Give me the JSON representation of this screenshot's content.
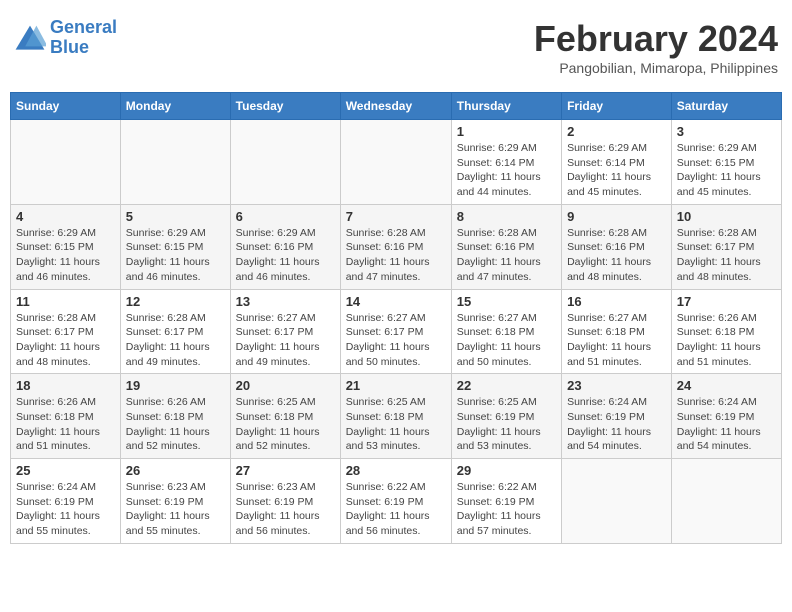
{
  "logo": {
    "line1": "General",
    "line2": "Blue"
  },
  "title": "February 2024",
  "location": "Pangobilian, Mimaropa, Philippines",
  "days_header": [
    "Sunday",
    "Monday",
    "Tuesday",
    "Wednesday",
    "Thursday",
    "Friday",
    "Saturday"
  ],
  "weeks": [
    [
      {
        "day": "",
        "info": ""
      },
      {
        "day": "",
        "info": ""
      },
      {
        "day": "",
        "info": ""
      },
      {
        "day": "",
        "info": ""
      },
      {
        "day": "1",
        "info": "Sunrise: 6:29 AM\nSunset: 6:14 PM\nDaylight: 11 hours and 44 minutes."
      },
      {
        "day": "2",
        "info": "Sunrise: 6:29 AM\nSunset: 6:14 PM\nDaylight: 11 hours and 45 minutes."
      },
      {
        "day": "3",
        "info": "Sunrise: 6:29 AM\nSunset: 6:15 PM\nDaylight: 11 hours and 45 minutes."
      }
    ],
    [
      {
        "day": "4",
        "info": "Sunrise: 6:29 AM\nSunset: 6:15 PM\nDaylight: 11 hours and 46 minutes."
      },
      {
        "day": "5",
        "info": "Sunrise: 6:29 AM\nSunset: 6:15 PM\nDaylight: 11 hours and 46 minutes."
      },
      {
        "day": "6",
        "info": "Sunrise: 6:29 AM\nSunset: 6:16 PM\nDaylight: 11 hours and 46 minutes."
      },
      {
        "day": "7",
        "info": "Sunrise: 6:28 AM\nSunset: 6:16 PM\nDaylight: 11 hours and 47 minutes."
      },
      {
        "day": "8",
        "info": "Sunrise: 6:28 AM\nSunset: 6:16 PM\nDaylight: 11 hours and 47 minutes."
      },
      {
        "day": "9",
        "info": "Sunrise: 6:28 AM\nSunset: 6:16 PM\nDaylight: 11 hours and 48 minutes."
      },
      {
        "day": "10",
        "info": "Sunrise: 6:28 AM\nSunset: 6:17 PM\nDaylight: 11 hours and 48 minutes."
      }
    ],
    [
      {
        "day": "11",
        "info": "Sunrise: 6:28 AM\nSunset: 6:17 PM\nDaylight: 11 hours and 48 minutes."
      },
      {
        "day": "12",
        "info": "Sunrise: 6:28 AM\nSunset: 6:17 PM\nDaylight: 11 hours and 49 minutes."
      },
      {
        "day": "13",
        "info": "Sunrise: 6:27 AM\nSunset: 6:17 PM\nDaylight: 11 hours and 49 minutes."
      },
      {
        "day": "14",
        "info": "Sunrise: 6:27 AM\nSunset: 6:17 PM\nDaylight: 11 hours and 50 minutes."
      },
      {
        "day": "15",
        "info": "Sunrise: 6:27 AM\nSunset: 6:18 PM\nDaylight: 11 hours and 50 minutes."
      },
      {
        "day": "16",
        "info": "Sunrise: 6:27 AM\nSunset: 6:18 PM\nDaylight: 11 hours and 51 minutes."
      },
      {
        "day": "17",
        "info": "Sunrise: 6:26 AM\nSunset: 6:18 PM\nDaylight: 11 hours and 51 minutes."
      }
    ],
    [
      {
        "day": "18",
        "info": "Sunrise: 6:26 AM\nSunset: 6:18 PM\nDaylight: 11 hours and 51 minutes."
      },
      {
        "day": "19",
        "info": "Sunrise: 6:26 AM\nSunset: 6:18 PM\nDaylight: 11 hours and 52 minutes."
      },
      {
        "day": "20",
        "info": "Sunrise: 6:25 AM\nSunset: 6:18 PM\nDaylight: 11 hours and 52 minutes."
      },
      {
        "day": "21",
        "info": "Sunrise: 6:25 AM\nSunset: 6:18 PM\nDaylight: 11 hours and 53 minutes."
      },
      {
        "day": "22",
        "info": "Sunrise: 6:25 AM\nSunset: 6:19 PM\nDaylight: 11 hours and 53 minutes."
      },
      {
        "day": "23",
        "info": "Sunrise: 6:24 AM\nSunset: 6:19 PM\nDaylight: 11 hours and 54 minutes."
      },
      {
        "day": "24",
        "info": "Sunrise: 6:24 AM\nSunset: 6:19 PM\nDaylight: 11 hours and 54 minutes."
      }
    ],
    [
      {
        "day": "25",
        "info": "Sunrise: 6:24 AM\nSunset: 6:19 PM\nDaylight: 11 hours and 55 minutes."
      },
      {
        "day": "26",
        "info": "Sunrise: 6:23 AM\nSunset: 6:19 PM\nDaylight: 11 hours and 55 minutes."
      },
      {
        "day": "27",
        "info": "Sunrise: 6:23 AM\nSunset: 6:19 PM\nDaylight: 11 hours and 56 minutes."
      },
      {
        "day": "28",
        "info": "Sunrise: 6:22 AM\nSunset: 6:19 PM\nDaylight: 11 hours and 56 minutes."
      },
      {
        "day": "29",
        "info": "Sunrise: 6:22 AM\nSunset: 6:19 PM\nDaylight: 11 hours and 57 minutes."
      },
      {
        "day": "",
        "info": ""
      },
      {
        "day": "",
        "info": ""
      }
    ]
  ]
}
